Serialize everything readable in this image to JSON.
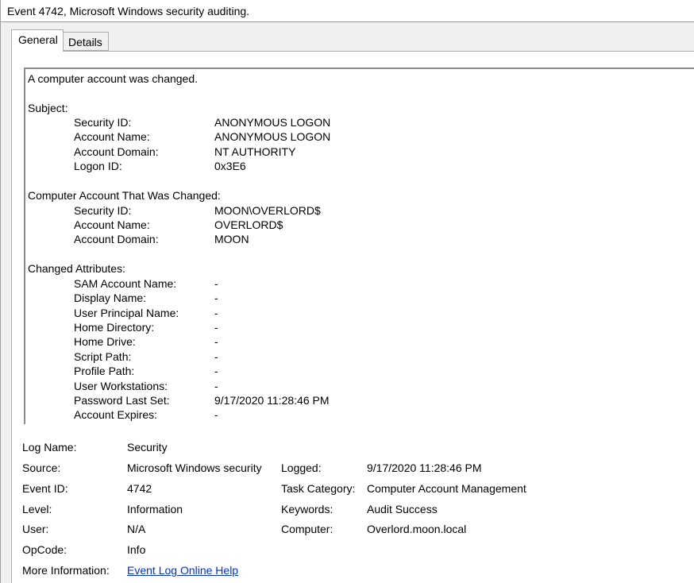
{
  "window": {
    "title": "Event 4742, Microsoft Windows security auditing."
  },
  "tabs": [
    {
      "label": "General",
      "selected": true
    },
    {
      "label": "Details",
      "selected": false
    }
  ],
  "description": {
    "summary": "A computer account was changed.",
    "subject": {
      "heading": "Subject:",
      "fields": [
        {
          "key": "Security ID:",
          "value": "ANONYMOUS LOGON"
        },
        {
          "key": "Account Name:",
          "value": "ANONYMOUS LOGON"
        },
        {
          "key": "Account Domain:",
          "value": "NT AUTHORITY"
        },
        {
          "key": "Logon ID:",
          "value": "0x3E6"
        }
      ]
    },
    "changed_account": {
      "heading": "Computer Account That Was Changed:",
      "fields": [
        {
          "key": "Security ID:",
          "value": "MOON\\OVERLORD$"
        },
        {
          "key": "Account Name:",
          "value": "OVERLORD$"
        },
        {
          "key": "Account Domain:",
          "value": "MOON"
        }
      ]
    },
    "changed_attributes": {
      "heading": "Changed Attributes:",
      "fields": [
        {
          "key": "SAM Account Name:",
          "value": "-"
        },
        {
          "key": "Display Name:",
          "value": "-"
        },
        {
          "key": "User Principal Name:",
          "value": "-"
        },
        {
          "key": "Home Directory:",
          "value": "-"
        },
        {
          "key": "Home Drive:",
          "value": "-"
        },
        {
          "key": "Script Path:",
          "value": "-"
        },
        {
          "key": "Profile Path:",
          "value": "-"
        },
        {
          "key": "User Workstations:",
          "value": "-"
        },
        {
          "key": "Password Last Set:",
          "value": "9/17/2020 11:28:46 PM"
        },
        {
          "key": "Account Expires:",
          "value": "-"
        }
      ]
    }
  },
  "properties": {
    "log_name": {
      "label": "Log Name:",
      "value": "Security"
    },
    "source": {
      "label": "Source:",
      "value": "Microsoft Windows security"
    },
    "logged": {
      "label": "Logged:",
      "value": "9/17/2020 11:28:46 PM"
    },
    "event_id": {
      "label": "Event ID:",
      "value": "4742"
    },
    "task_category": {
      "label": "Task Category:",
      "value": "Computer Account Management"
    },
    "level": {
      "label": "Level:",
      "value": "Information"
    },
    "keywords": {
      "label": "Keywords:",
      "value": "Audit Success"
    },
    "user": {
      "label": "User:",
      "value": "N/A"
    },
    "computer": {
      "label": "Computer:",
      "value": "Overlord.moon.local"
    },
    "opcode": {
      "label": "OpCode:",
      "value": "Info"
    },
    "more_information": {
      "label": "More Information:",
      "link_text": "Event Log Online Help"
    }
  },
  "colors": {
    "link": "#0033cc",
    "panel_background": "#ffffff",
    "window_background": "#f0f0f0"
  }
}
